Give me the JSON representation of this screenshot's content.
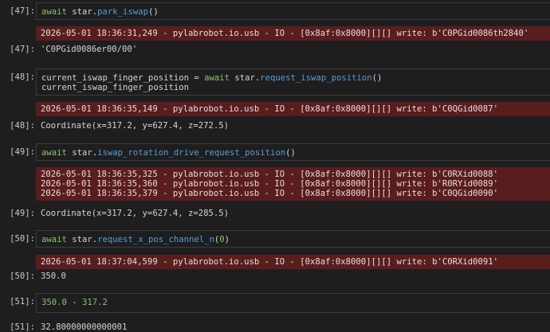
{
  "cells": [
    {
      "input_label": "[47]:",
      "code": [
        [
          {
            "t": "await",
            "c": "kw2"
          },
          {
            "t": " star.",
            "c": "plain"
          },
          {
            "t": "park_iswap",
            "c": "fn"
          },
          {
            "t": "()",
            "c": "plain"
          }
        ]
      ],
      "logs": [
        "2026-05-01 18:36:31,249 - pylabrobot.io.usb - IO - [0x8af:0x8000][][] write: b'C0PGid0086th2840'"
      ],
      "output_label": "[47]:",
      "output": "'C0PGid0086er00/00'"
    },
    {
      "input_label": "[48]:",
      "code": [
        [
          {
            "t": "current_iswap_finger_position = ",
            "c": "plain"
          },
          {
            "t": "await",
            "c": "kw2"
          },
          {
            "t": " star.",
            "c": "plain"
          },
          {
            "t": "request_iswap_position",
            "c": "fn"
          },
          {
            "t": "()",
            "c": "plain"
          }
        ],
        [
          {
            "t": "current_iswap_finger_position",
            "c": "plain"
          }
        ]
      ],
      "logs": [
        "2026-05-01 18:36:35,149 - pylabrobot.io.usb - IO - [0x8af:0x8000][][] write: b'C0QGid0087'"
      ],
      "output_label": "[48]:",
      "output": "Coordinate(x=317.2, y=627.4, z=272.5)"
    },
    {
      "input_label": "[49]:",
      "code": [
        [
          {
            "t": "await",
            "c": "kw2"
          },
          {
            "t": " star.",
            "c": "plain"
          },
          {
            "t": "iswap_rotation_drive_request_position",
            "c": "fn"
          },
          {
            "t": "()",
            "c": "plain"
          }
        ]
      ],
      "logs": [
        "2026-05-01 18:36:35,325 - pylabrobot.io.usb - IO - [0x8af:0x8000][][] write: b'C0RXid0088'",
        "2026-05-01 18:36:35,360 - pylabrobot.io.usb - IO - [0x8af:0x8000][][] write: b'R0RYid0089'",
        "2026-05-01 18:36:35,379 - pylabrobot.io.usb - IO - [0x8af:0x8000][][] write: b'C0QGid0090'"
      ],
      "output_label": "[49]:",
      "output": "Coordinate(x=317.2, y=627.4, z=285.5)"
    },
    {
      "input_label": "[50]:",
      "code": [
        [
          {
            "t": "await",
            "c": "kw2"
          },
          {
            "t": " star.",
            "c": "plain"
          },
          {
            "t": "request_x_pos_channel_n",
            "c": "fn"
          },
          {
            "t": "(",
            "c": "plain"
          },
          {
            "t": "0",
            "c": "num"
          },
          {
            "t": ")",
            "c": "plain"
          }
        ]
      ],
      "logs": [
        "2026-05-01 18:37:04,599 - pylabrobot.io.usb - IO - [0x8af:0x8000][][] write: b'C0RXid0091'"
      ],
      "output_label": "[50]:",
      "output": "350.0"
    },
    {
      "input_label": "[51]:",
      "code": [
        [
          {
            "t": "350.0",
            "c": "num"
          },
          {
            "t": " - ",
            "c": "plain"
          },
          {
            "t": "317.2",
            "c": "num"
          }
        ]
      ],
      "logs": [],
      "output_label": "[51]:",
      "output": "32.80000000000001"
    }
  ]
}
